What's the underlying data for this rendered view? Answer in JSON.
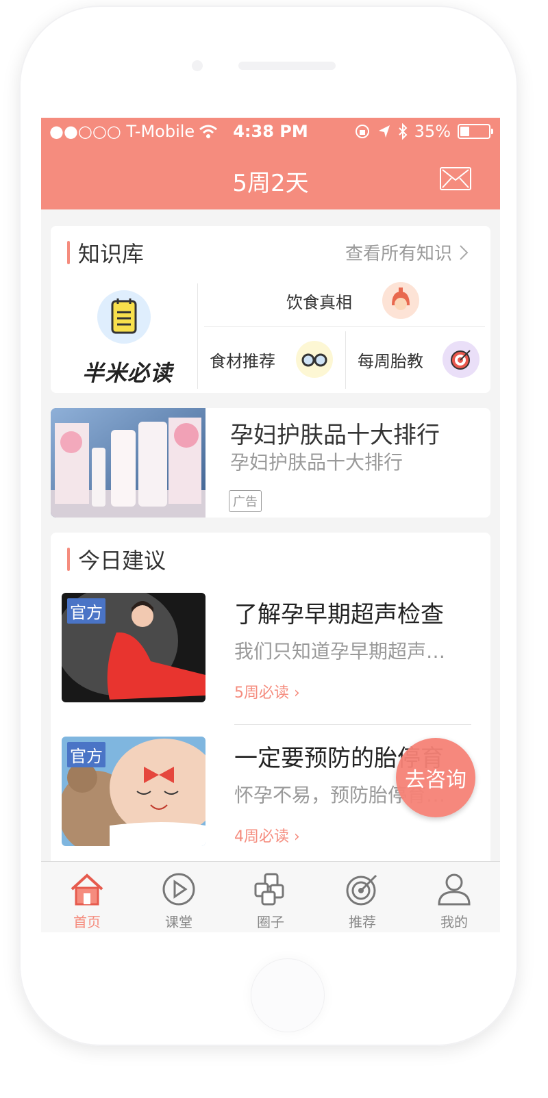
{
  "status_bar": {
    "carrier": "●●○○○ T-Mobile",
    "time": "4:38 PM",
    "battery": "35%",
    "battery_level": 0.35
  },
  "nav": {
    "title": "5周2天"
  },
  "knowledge": {
    "title": "知识库",
    "more": "查看所有知识",
    "brand": "半米必读",
    "items": [
      {
        "label": "饮食真相",
        "icon": "girl-face-icon"
      },
      {
        "label": "食材推荐",
        "icon": "glasses-icon"
      },
      {
        "label": "每周胎教",
        "icon": "target-icon"
      }
    ]
  },
  "ad": {
    "title": "孕妇护肤品十大排行",
    "subtitle": "孕妇护肤品十大排行",
    "tag": "广告"
  },
  "tips": {
    "title": "今日建议",
    "articles": [
      {
        "badge": "官方",
        "title": "了解孕早期超声检查",
        "summary": "我们只知道孕早期超声…",
        "tag": "5周必读 ›"
      },
      {
        "badge": "官方",
        "title": "一定要预防的胎停育",
        "summary": "怀孕不易，预防胎停育…",
        "tag": "4周必读 ›"
      }
    ]
  },
  "consult_button": "去咨询",
  "tabbar": {
    "tabs": [
      {
        "label": "首页",
        "icon": "home-icon",
        "active": true
      },
      {
        "label": "课堂",
        "icon": "play-icon",
        "active": false
      },
      {
        "label": "圈子",
        "icon": "circles-icon",
        "active": false
      },
      {
        "label": "推荐",
        "icon": "target-icon",
        "active": false
      },
      {
        "label": "我的",
        "icon": "user-icon",
        "active": false
      }
    ]
  },
  "colors": {
    "accent": "#f58c7e",
    "badge": "#4a74c6"
  }
}
